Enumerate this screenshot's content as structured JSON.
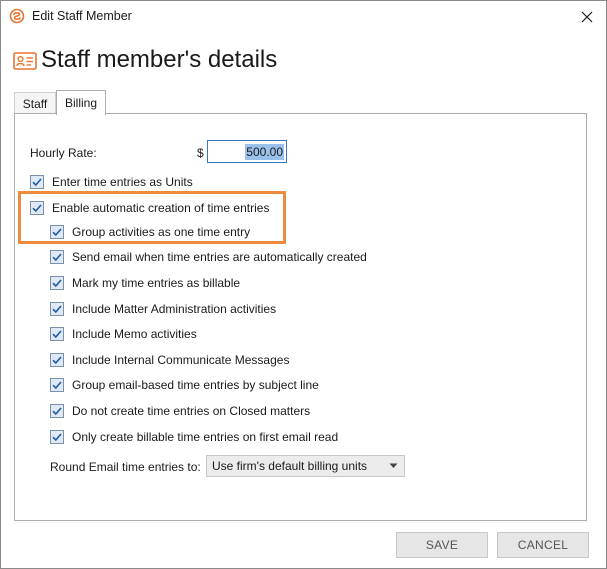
{
  "window": {
    "title": "Edit Staff Member"
  },
  "header": {
    "title": "Staff member's details"
  },
  "tabs": [
    {
      "label": "Staff",
      "active": false
    },
    {
      "label": "Billing",
      "active": true
    }
  ],
  "billing": {
    "hourly_rate_label": "Hourly Rate:",
    "currency_symbol": "$",
    "hourly_rate_value": "500.00",
    "checkboxes": [
      {
        "label": "Enter time entries as Units",
        "checked": true
      },
      {
        "label": "Enable automatic creation of time entries",
        "checked": true
      },
      {
        "label": "Group activities as one time entry",
        "checked": true
      },
      {
        "label": "Send email when time entries are automatically created",
        "checked": true
      },
      {
        "label": "Mark my time entries as billable",
        "checked": true
      },
      {
        "label": "Include Matter Administration activities",
        "checked": true
      },
      {
        "label": "Include Memo activities",
        "checked": true
      },
      {
        "label": "Include Internal Communicate Messages",
        "checked": true
      },
      {
        "label": "Group email-based time entries by subject line",
        "checked": true
      },
      {
        "label": "Do not create time entries on Closed matters",
        "checked": true
      },
      {
        "label": "Only create billable time entries on first email read",
        "checked": true
      }
    ],
    "round_label": "Round Email time entries to:",
    "round_selected": "Use firm's default billing units"
  },
  "footer": {
    "save_label": "SAVE",
    "cancel_label": "CANCEL"
  },
  "colors": {
    "accent_orange": "#ee8b3f",
    "checkbox_check": "#1c5aa8",
    "input_border": "#3a75c4",
    "selection": "#99c1ec"
  }
}
